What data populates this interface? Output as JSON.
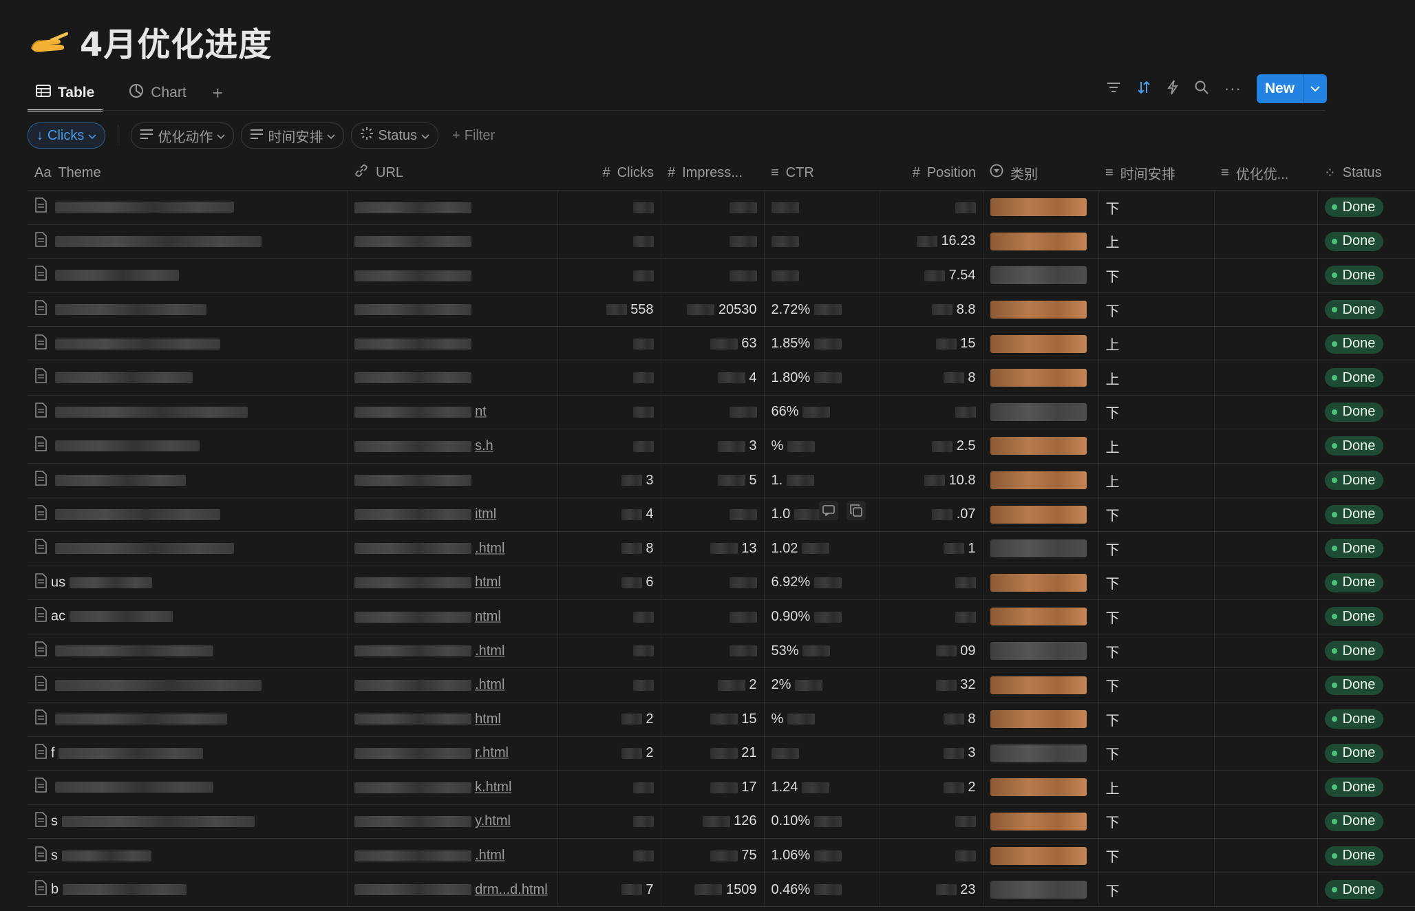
{
  "page": {
    "emoji_icon": "hand-pointing-icon",
    "title": "4月优化进度"
  },
  "tabs": [
    {
      "label": "Table",
      "icon": "table-icon"
    },
    {
      "label": "Chart",
      "icon": "chart-icon"
    }
  ],
  "toolbar": {
    "new_label": "New"
  },
  "filters": {
    "sort_label": "Clicks",
    "chip1": "优化动作",
    "chip2": "时间安排",
    "chip3": "Status",
    "add_filter": "Filter"
  },
  "columns": {
    "theme": "Theme",
    "url": "URL",
    "clicks": "Clicks",
    "impressions": "Impress...",
    "ctr": "CTR",
    "position": "Position",
    "category": "类别",
    "schedule": "时间安排",
    "optimize": "优化优...",
    "status": "Status"
  },
  "rows": [
    {
      "theme": "",
      "url": "",
      "clicks": "",
      "impr": "",
      "ctr": "",
      "pos": "",
      "cat": "orange",
      "sched": "下",
      "status": "Done"
    },
    {
      "theme": "",
      "url": "",
      "clicks": "",
      "impr": "",
      "ctr": "",
      "pos": "16.23",
      "cat": "orange",
      "sched": "上",
      "status": "Done"
    },
    {
      "theme": "",
      "url": "",
      "clicks": "",
      "impr": "",
      "ctr": "",
      "pos": "7.54",
      "cat": "grey",
      "sched": "下",
      "status": "Done"
    },
    {
      "theme": "",
      "url": "",
      "clicks": "558",
      "impr": "20530",
      "ctr": "2.72%",
      "pos": "8.8",
      "cat": "orange",
      "sched": "下",
      "status": "Done"
    },
    {
      "theme": "",
      "url": "",
      "clicks": "",
      "impr": "63",
      "ctr": "1.85%",
      "pos": "15",
      "cat": "orange",
      "sched": "上",
      "status": "Done"
    },
    {
      "theme": "",
      "url": "",
      "clicks": "",
      "impr": "4",
      "ctr": "1.80%",
      "pos": "8",
      "cat": "orange",
      "sched": "上",
      "status": "Done"
    },
    {
      "theme": "",
      "url": "nt",
      "clicks": "",
      "impr": "",
      "ctr": "66%",
      "pos": "",
      "cat": "grey",
      "sched": "下",
      "status": "Done"
    },
    {
      "theme": "",
      "url": "s.h",
      "clicks": "",
      "impr": "3",
      "ctr": "%",
      "pos": "2.5",
      "cat": "orange",
      "sched": "上",
      "status": "Done"
    },
    {
      "theme": "",
      "url": "",
      "clicks": "3",
      "impr": "5",
      "ctr": "1.",
      "pos": "10.8",
      "cat": "orange",
      "sched": "上",
      "status": "Done"
    },
    {
      "theme": "",
      "url": "itml",
      "clicks": "4",
      "impr": "",
      "ctr": "1.0",
      "pos": ".07",
      "cat": "orange",
      "sched": "下",
      "status": "Done"
    },
    {
      "theme": "",
      "url": ".html",
      "clicks": "8",
      "impr": "13",
      "ctr": "1.02",
      "pos": "1",
      "cat": "grey",
      "sched": "下",
      "status": "Done"
    },
    {
      "theme": "us",
      "url": "html",
      "clicks": "6",
      "impr": "",
      "ctr": "6.92%",
      "pos": "",
      "cat": "orange",
      "sched": "下",
      "status": "Done"
    },
    {
      "theme": "ac",
      "url": "ntml",
      "clicks": "",
      "impr": "",
      "ctr": "0.90%",
      "pos": "",
      "cat": "orange",
      "sched": "下",
      "status": "Done"
    },
    {
      "theme": "",
      "url": ".html",
      "clicks": "",
      "impr": "",
      "ctr": "53%",
      "pos": "09",
      "cat": "grey",
      "sched": "下",
      "status": "Done"
    },
    {
      "theme": "",
      "url": ".html",
      "clicks": "",
      "impr": "2",
      "ctr": "2%",
      "pos": "32",
      "cat": "orange",
      "sched": "下",
      "status": "Done"
    },
    {
      "theme": "",
      "url": "html",
      "clicks": "2",
      "impr": "15",
      "ctr": "%",
      "pos": "8",
      "cat": "orange",
      "sched": "下",
      "status": "Done"
    },
    {
      "theme": "f",
      "url": "r.html",
      "clicks": "2",
      "impr": "21",
      "ctr": "",
      "pos": "3",
      "cat": "grey",
      "sched": "下",
      "status": "Done"
    },
    {
      "theme": "",
      "url": "k.html",
      "clicks": "",
      "impr": "17",
      "ctr": "1.24",
      "pos": "2",
      "cat": "orange",
      "sched": "上",
      "status": "Done"
    },
    {
      "theme": "s",
      "url": "y.html",
      "clicks": "",
      "impr": "126",
      "ctr": "0.10%",
      "pos": "",
      "cat": "orange",
      "sched": "下",
      "status": "Done"
    },
    {
      "theme": "s",
      "url": ".html",
      "clicks": "",
      "impr": "75",
      "ctr": "1.06%",
      "pos": "",
      "cat": "orange",
      "sched": "下",
      "status": "Done"
    },
    {
      "theme": "b",
      "url": "drm...d.html",
      "clicks": "7",
      "impr": "1509",
      "ctr": "0.46%",
      "pos": "23",
      "cat": "grey",
      "sched": "下",
      "status": "Done"
    }
  ]
}
